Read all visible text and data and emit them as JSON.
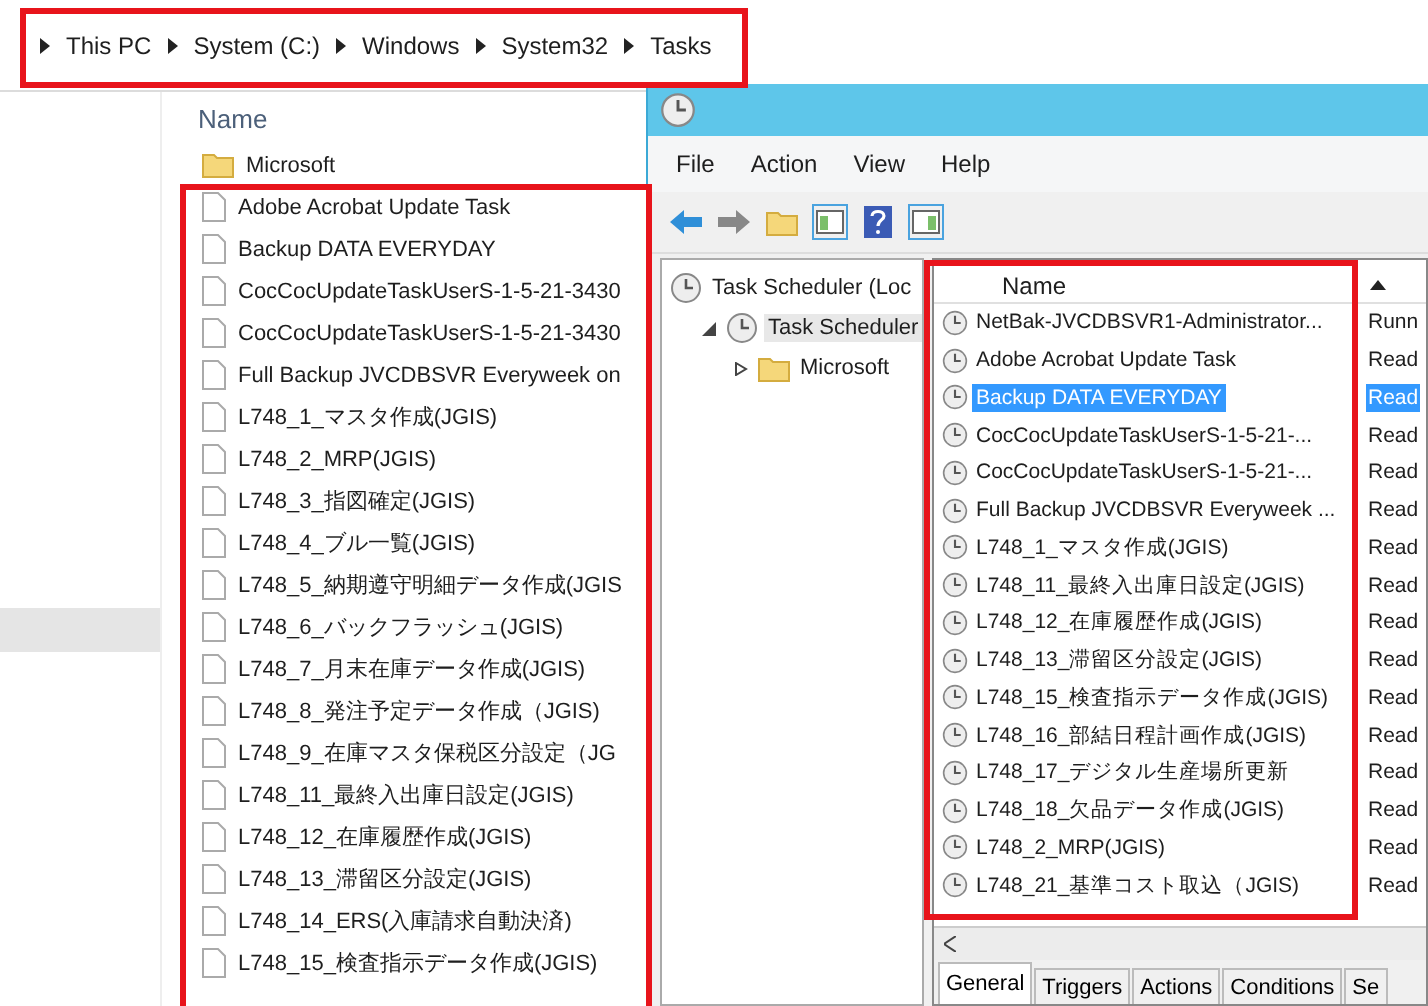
{
  "explorer": {
    "breadcrumb": [
      "This PC",
      "System (C:)",
      "Windows",
      "System32",
      "Tasks"
    ],
    "column_header": "Name",
    "folder": "Microsoft",
    "files": [
      "Adobe Acrobat Update Task",
      "Backup DATA EVERYDAY",
      "CocCocUpdateTaskUserS-1-5-21-3430",
      "CocCocUpdateTaskUserS-1-5-21-3430",
      "Full Backup JVCDBSVR Everyweek on",
      "L748_1_マスタ作成(JGIS)",
      "L748_2_MRP(JGIS)",
      "L748_3_指図確定(JGIS)",
      "L748_4_ブル一覧(JGIS)",
      "L748_5_納期遵守明細データ作成(JGIS",
      "L748_6_バックフラッシュ(JGIS)",
      "L748_7_月末在庫データ作成(JGIS)",
      "L748_8_発注予定データ作成（JGIS)",
      "L748_9_在庫マスタ保税区分設定（JG",
      "L748_11_最終入出庫日設定(JGIS)",
      "L748_12_在庫履歴作成(JGIS)",
      "L748_13_滞留区分設定(JGIS)",
      "L748_14_ERS(入庫請求自動決済)",
      "L748_15_検査指示データ作成(JGIS)"
    ]
  },
  "task_scheduler": {
    "menu": [
      "File",
      "Action",
      "View",
      "Help"
    ],
    "tree": [
      {
        "label": "Task Scheduler (Loc",
        "selected": false,
        "children": [
          {
            "label": "Task Scheduler",
            "selected": true,
            "expanded": true,
            "children": [
              {
                "label": "Microsoft",
                "selected": false,
                "expanded": false
              }
            ]
          }
        ]
      }
    ],
    "list": {
      "column": "Name",
      "rows": [
        {
          "name": "NetBak-JVCDBSVR1-Administrator...",
          "status": "Runn",
          "selected": false
        },
        {
          "name": "Adobe Acrobat Update Task",
          "status": "Read",
          "selected": false
        },
        {
          "name": "Backup DATA EVERYDAY",
          "status": "Read",
          "selected": true
        },
        {
          "name": "CocCocUpdateTaskUserS-1-5-21-...",
          "status": "Read",
          "selected": false
        },
        {
          "name": "CocCocUpdateTaskUserS-1-5-21-...",
          "status": "Read",
          "selected": false
        },
        {
          "name": "Full Backup JVCDBSVR Everyweek ...",
          "status": "Read",
          "selected": false
        },
        {
          "name": "L748_1_マスタ作成(JGIS)",
          "status": "Read",
          "selected": false
        },
        {
          "name": "L748_11_最終入出庫日設定(JGIS)",
          "status": "Read",
          "selected": false
        },
        {
          "name": "L748_12_在庫履歴作成(JGIS)",
          "status": "Read",
          "selected": false
        },
        {
          "name": "L748_13_滞留区分設定(JGIS)",
          "status": "Read",
          "selected": false
        },
        {
          "name": "L748_15_検査指示データ作成(JGIS)",
          "status": "Read",
          "selected": false
        },
        {
          "name": "L748_16_部結日程計画作成(JGIS)",
          "status": "Read",
          "selected": false
        },
        {
          "name": "L748_17_デジタル生産場所更新",
          "status": "Read",
          "selected": false
        },
        {
          "name": "L748_18_欠品データ作成(JGIS)",
          "status": "Read",
          "selected": false
        },
        {
          "name": "L748_2_MRP(JGIS)",
          "status": "Read",
          "selected": false
        },
        {
          "name": "L748_21_基準コスト取込（JGIS)",
          "status": "Read",
          "selected": false
        }
      ]
    },
    "tabs": [
      {
        "label": "General",
        "selected": true
      },
      {
        "label": "Triggers",
        "selected": false
      },
      {
        "label": "Actions",
        "selected": false
      },
      {
        "label": "Conditions",
        "selected": false
      },
      {
        "label": "Se",
        "selected": false
      }
    ]
  }
}
